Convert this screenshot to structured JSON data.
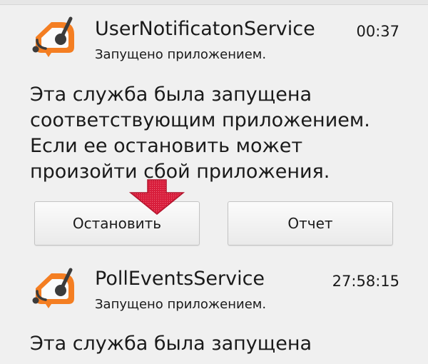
{
  "services": [
    {
      "name": "UserNotificatonService",
      "time": "00:37",
      "subtitle": "Запущено приложением.",
      "description": "Эта служба была запущена\nсоответствующим приложением.\nЕсли ее остановить может\nпроизойти сбой приложения.",
      "icon": "app-logo-icon",
      "buttons": {
        "stop_label": "Остановить",
        "report_label": "Отчет"
      }
    },
    {
      "name": "PollEventsService",
      "time": "27:58:15",
      "subtitle": "Запущено приложением.",
      "description": "Эта служба была запущена",
      "icon": "app-logo-icon"
    }
  ],
  "annotation": {
    "icon": "down-arrow-icon",
    "color": "#d81e3c"
  },
  "colors": {
    "background": "#f0f0f0",
    "logo_orange": "#f47e22",
    "logo_dark": "#3b3b3b"
  }
}
